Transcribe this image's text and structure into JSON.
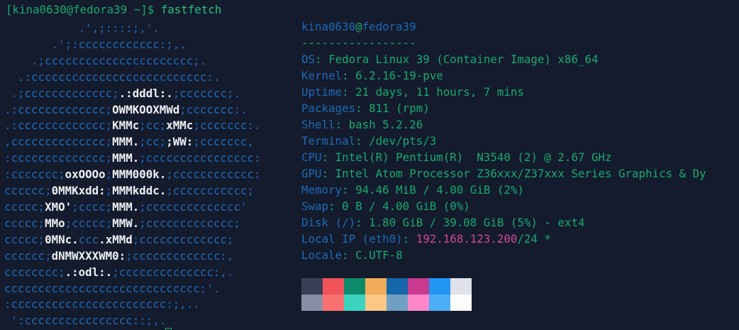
{
  "terminal": {
    "prompt": "[kina0630@fedora39 ~]$ ",
    "command": "fastfetch"
  },
  "logo_lines": [
    "           .',;::::;,'.",
    "       .';:cccccccccccc:;,.",
    "    .;cccccccccccccccccccccc;.",
    "  .:cccccccccccccccccccccccccc:.",
    " .;ccccccccccccc;[.:dddl:.];ccccccc;.",
    ".:ccccccccccccc;[OWMKOOXMWd];ccccccc:.",
    ".:ccccccccccccc;[KMMc];cc;[xMMc];ccccccc:.",
    ",cccccccccccccc;[MMM.];cc;[;WW:];ccccccc,",
    ":cccccccccccccc;[MMM.];cccccccccccccccc:",
    ":ccccccc;[oxOOOo];[MMM000k.];cccccccccccc:",
    "cccccc;[0MMKxdd:];[MMMkddc.];ccccccccccc;",
    "ccccc;[XMO'];cccc;[MMM.];cccccccccccccc'",
    "ccccc;[MMo];ccccc;[MMW.];ccccccccccccc;",
    "ccccc;[0MNc.]ccc[.xMMd];ccccccccccccc;",
    "cccccc;[dNMWXXXWM0:];ccccccccccccc:,",
    "cccccccc;[.:odl:.];cccccccccccccc:,.",
    "ccccccccccccccccccccccccccccc:'.",
    ":ccccccccccccccccccccccc:;,..",
    " ':cccccccccccccccc::;,."
  ],
  "info": {
    "user": "kina0630",
    "at": "@",
    "host": "fedora39",
    "separator": "-----------------",
    "rows": [
      {
        "key": "OS",
        "value": "Fedora Linux 39 (Container Image) x86_64"
      },
      {
        "key": "Kernel",
        "value": "6.2.16-19-pve"
      },
      {
        "key": "Uptime",
        "value": "21 days, 11 hours, 7 mins"
      },
      {
        "key": "Packages",
        "value": "811 (rpm)"
      },
      {
        "key": "Shell",
        "value": "bash 5.2.26"
      },
      {
        "key": "Terminal",
        "value": "/dev/pts/3"
      },
      {
        "key": "CPU",
        "value": "Intel(R) Pentium(R)  N3540 (2) @ 2.67 GHz"
      },
      {
        "key": "GPU",
        "value": "Intel Atom Processor Z36xxx/Z37xxx Series Graphics & Dy"
      },
      {
        "key": "Memory",
        "value": "94.46 MiB / 4.00 GiB (",
        "pct": "2%",
        "tail": ")"
      },
      {
        "key": "Swap",
        "value": "0 B / 4.00 GiB (",
        "pct": "0%",
        "tail": ")"
      },
      {
        "key": "Disk (/)",
        "value": "1.80 GiB / 39.08 GiB (",
        "pct": "5%",
        "tail": ") - ext4"
      },
      {
        "key": "Local IP (eth0)",
        "value": "",
        "ip": "192.168.123.200",
        "tail": "/24 *"
      },
      {
        "key": "Locale",
        "value": "C.UTF-8"
      }
    ]
  },
  "colors": {
    "background": "#141b2d",
    "key": "#1e6ab6",
    "text": "#19a96e",
    "logo_fg": "#1e6ab6",
    "logo_hl": "#eef0f4",
    "ip": "#d0479a"
  },
  "palette": {
    "normal": [
      "#3a3f58",
      "#f0545a",
      "#0d8a6a",
      "#f0ab5a",
      "#1467aa",
      "#c73a8f",
      "#2395f2",
      "#dfe2e8"
    ],
    "bright": [
      "#888ea5",
      "#fa6f6f",
      "#3ad4c0",
      "#fcc882",
      "#6fa0c3",
      "#ff86c8",
      "#4caef6",
      "#fcfcfc"
    ]
  }
}
